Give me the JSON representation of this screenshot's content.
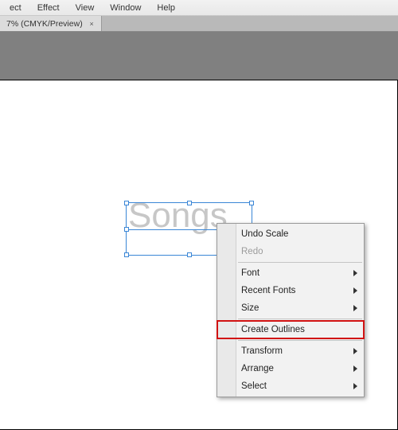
{
  "menubar": {
    "items": [
      {
        "label": "ect"
      },
      {
        "label": "Effect"
      },
      {
        "label": "View"
      },
      {
        "label": "Window"
      },
      {
        "label": "Help"
      }
    ]
  },
  "tab": {
    "label": "7% (CMYK/Preview)",
    "close_glyph": "×"
  },
  "text_object": {
    "content": "Songs"
  },
  "context_menu": {
    "items": [
      {
        "label": "Undo Scale",
        "enabled": true,
        "submenu": false
      },
      {
        "label": "Redo",
        "enabled": false,
        "submenu": false
      }
    ],
    "font_group": [
      {
        "label": "Font",
        "enabled": true,
        "submenu": true
      },
      {
        "label": "Recent Fonts",
        "enabled": true,
        "submenu": true
      },
      {
        "label": "Size",
        "enabled": true,
        "submenu": true
      }
    ],
    "create_outlines": {
      "label": "Create Outlines",
      "enabled": true,
      "submenu": false,
      "highlight": true
    },
    "arrange_group": [
      {
        "label": "Transform",
        "enabled": true,
        "submenu": true
      },
      {
        "label": "Arrange",
        "enabled": true,
        "submenu": true
      },
      {
        "label": "Select",
        "enabled": true,
        "submenu": true
      }
    ]
  }
}
